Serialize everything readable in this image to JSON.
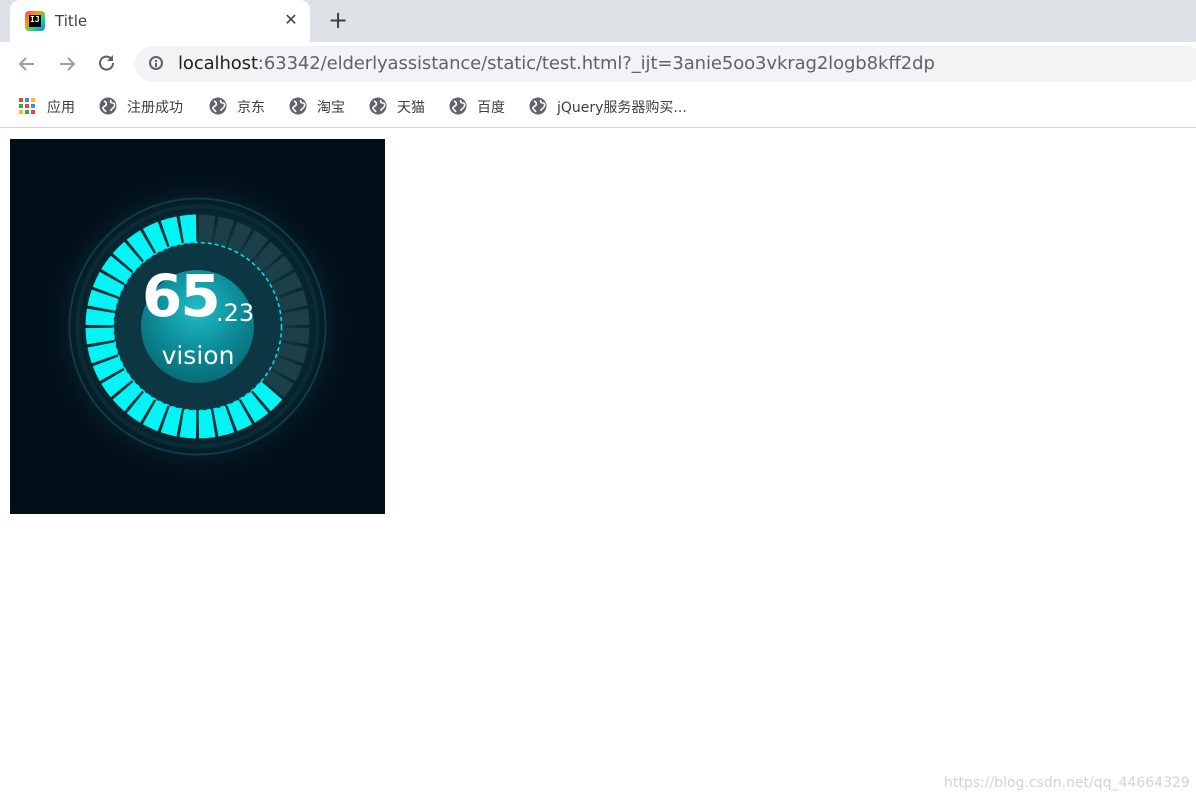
{
  "browser": {
    "tab": {
      "title": "Title",
      "favicon_text": "IJ",
      "close_icon": "close-icon"
    },
    "new_tab_label": "+",
    "url": {
      "host": "localhost",
      "rest": ":63342/elderlyassistance/static/test.html?_ijt=3anie5oo3vkrag2logb8kff2dp"
    },
    "bookmarks": [
      {
        "label": "应用",
        "icon": "apps-grid-icon"
      },
      {
        "label": "注册成功",
        "icon": "globe-icon"
      },
      {
        "label": "京东",
        "icon": "globe-icon"
      },
      {
        "label": "淘宝",
        "icon": "globe-icon"
      },
      {
        "label": "天猫",
        "icon": "globe-icon"
      },
      {
        "label": "百度",
        "icon": "globe-icon"
      },
      {
        "label": "jQuery服务器购买...",
        "icon": "globe-icon"
      }
    ]
  },
  "gauge": {
    "value_integer": "65",
    "value_decimal": ".23",
    "label": "vision",
    "value": 65.23,
    "max": 100,
    "colors": {
      "active": "#00f5f5",
      "inactive": "#1c3f49",
      "background": "#020f18",
      "center": "#0c8d99"
    }
  },
  "watermark": "https://blog.csdn.net/qq_44664329"
}
